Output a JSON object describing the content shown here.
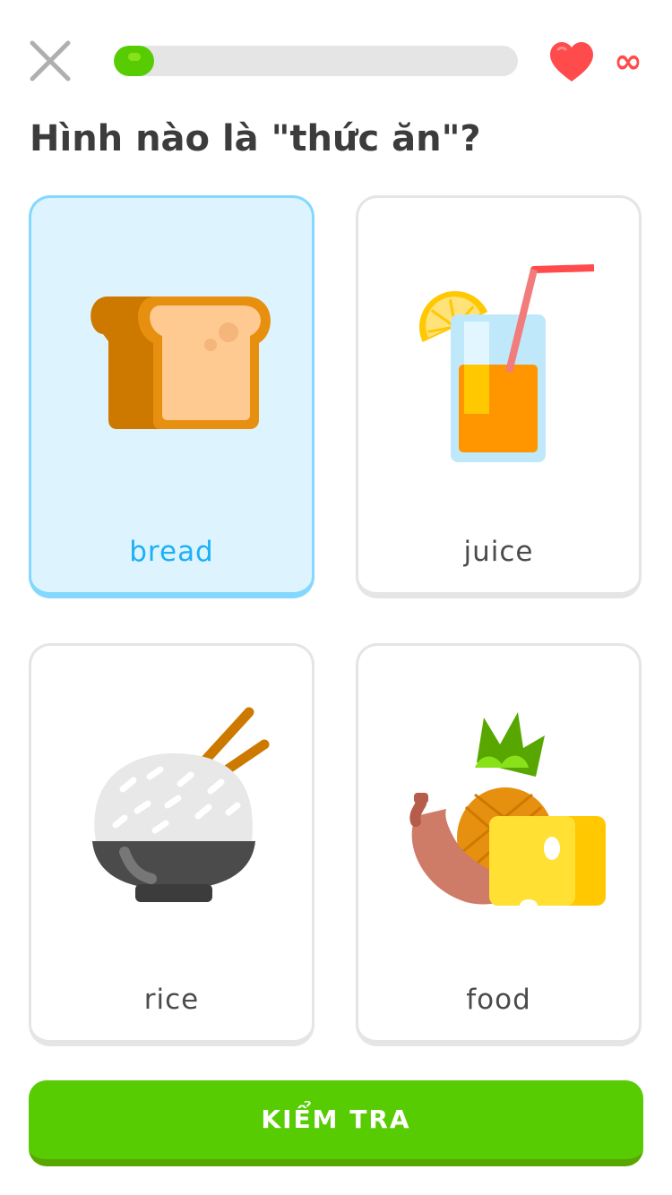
{
  "header": {
    "close_icon": "close-icon",
    "progress_fraction": 0.1,
    "heart_icon": "heart-icon",
    "lives": "∞"
  },
  "question": "Hình nào là \"thức ăn\"?",
  "options": [
    {
      "label": "bread",
      "selected": true,
      "icon": "bread-icon"
    },
    {
      "label": "juice",
      "selected": false,
      "icon": "juice-icon"
    },
    {
      "label": "rice",
      "selected": false,
      "icon": "rice-bowl-icon"
    },
    {
      "label": "food",
      "selected": false,
      "icon": "food-icon"
    }
  ],
  "check_button": {
    "label": "KIỂM TRA"
  },
  "colors": {
    "accent_green": "#58cc02",
    "selected_blue": "#1cb0f6",
    "heart_red": "#ff4b4b",
    "selected_bg": "#ddf4ff"
  }
}
